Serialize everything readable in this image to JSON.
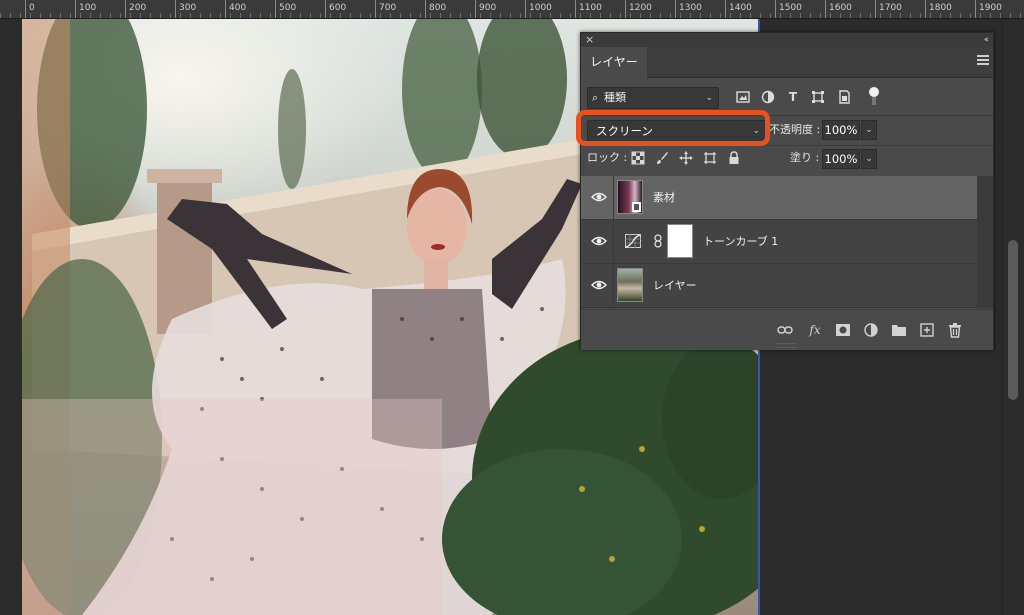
{
  "ruler": {
    "marks": [
      "0",
      "100",
      "200",
      "300",
      "400",
      "500",
      "600",
      "700",
      "800",
      "900",
      "1000",
      "1100",
      "1200",
      "1300",
      "1400",
      "1500",
      "1600",
      "1700",
      "1800",
      "1900"
    ]
  },
  "panel": {
    "tab_label": "レイヤー",
    "filter": {
      "label": "種類"
    },
    "blend_mode": "スクリーン",
    "opacity_label": "不透明度 :",
    "opacity_value": "100%",
    "lock_label": "ロック :",
    "fill_label": "塗り :",
    "fill_value": "100%",
    "layers": [
      {
        "name": "素材",
        "visible": true,
        "selected": true
      },
      {
        "name": "トーンカーブ 1",
        "visible": true,
        "selected": false
      },
      {
        "name": "レイヤー",
        "visible": true,
        "selected": false
      }
    ]
  },
  "colors": {
    "highlight": "#e8501e",
    "selected_row": "#646464",
    "panel_bg": "#4a4a4a",
    "canvas_edge": "#3a57a6"
  }
}
